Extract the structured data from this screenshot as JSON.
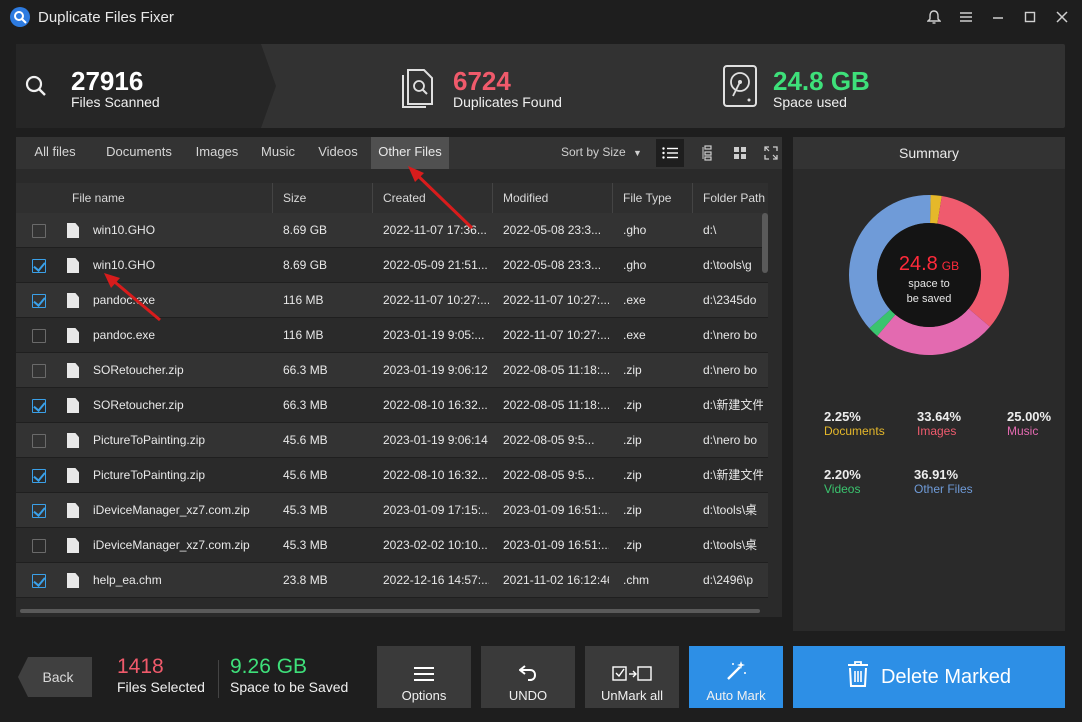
{
  "app": {
    "title": "Duplicate Files Fixer"
  },
  "stats": {
    "scanned": {
      "value": "27916",
      "label": "Files Scanned"
    },
    "duplicates": {
      "value": "6724",
      "label": "Duplicates Found"
    },
    "space": {
      "value": "24.8 GB",
      "label": "Space used"
    }
  },
  "tabs": [
    "All files",
    "Documents",
    "Images",
    "Music",
    "Videos",
    "Other Files"
  ],
  "sort_label": "Sort by Size",
  "columns": [
    "File name",
    "Size",
    "Created",
    "Modified",
    "File Type",
    "Folder Path"
  ],
  "rows": [
    {
      "checked": false,
      "name": "win10.GHO",
      "size": "8.69 GB",
      "created": "2022-11-07 17:36...",
      "modified": "2022-05-08 23:3...",
      "type": ".gho",
      "path": "d:\\"
    },
    {
      "checked": true,
      "name": "win10.GHO",
      "size": "8.69 GB",
      "created": "2022-05-09 21:51...",
      "modified": "2022-05-08 23:3...",
      "type": ".gho",
      "path": "d:\\tools\\g"
    },
    {
      "checked": true,
      "name": "pandoc.exe",
      "size": "116 MB",
      "created": "2022-11-07 10:27:...",
      "modified": "2022-11-07 10:27:...",
      "type": ".exe",
      "path": "d:\\2345do"
    },
    {
      "checked": false,
      "name": "pandoc.exe",
      "size": "116 MB",
      "created": "2023-01-19 9:05:...",
      "modified": "2022-11-07 10:27:...",
      "type": ".exe",
      "path": "d:\\nero bo"
    },
    {
      "checked": false,
      "name": "SORetoucher.zip",
      "size": "66.3 MB",
      "created": "2023-01-19 9:06:12",
      "modified": "2022-08-05 11:18:...",
      "type": ".zip",
      "path": "d:\\nero bo"
    },
    {
      "checked": true,
      "name": "SORetoucher.zip",
      "size": "66.3 MB",
      "created": "2022-08-10 16:32...",
      "modified": "2022-08-05 11:18:...",
      "type": ".zip",
      "path": "d:\\新建文件"
    },
    {
      "checked": false,
      "name": "PictureToPainting.zip",
      "size": "45.6 MB",
      "created": "2023-01-19 9:06:14",
      "modified": "2022-08-05 9:5...",
      "type": ".zip",
      "path": "d:\\nero bo"
    },
    {
      "checked": true,
      "name": "PictureToPainting.zip",
      "size": "45.6 MB",
      "created": "2022-08-10 16:32...",
      "modified": "2022-08-05 9:5...",
      "type": ".zip",
      "path": "d:\\新建文件"
    },
    {
      "checked": true,
      "name": "iDeviceManager_xz7.com.zip",
      "size": "45.3 MB",
      "created": "2023-01-09 17:15:...",
      "modified": "2023-01-09 16:51:...",
      "type": ".zip",
      "path": "d:\\tools\\桌"
    },
    {
      "checked": false,
      "name": "iDeviceManager_xz7.com.zip",
      "size": "45.3 MB",
      "created": "2023-02-02 10:10...",
      "modified": "2023-01-09 16:51:...",
      "type": ".zip",
      "path": "d:\\tools\\桌"
    },
    {
      "checked": true,
      "name": "help_ea.chm",
      "size": "23.8 MB",
      "created": "2022-12-16 14:57:...",
      "modified": "2021-11-02 16:12:46",
      "type": ".chm",
      "path": "d:\\2496\\p"
    }
  ],
  "summary": {
    "title": "Summary",
    "center_value": "24.8",
    "center_unit": "GB",
    "center_text_1": "space to",
    "center_text_2": "be saved",
    "legend": [
      {
        "pct": "2.25%",
        "label": "Documents",
        "color": "#e5b82a",
        "share": 2.25
      },
      {
        "pct": "33.64%",
        "label": "Images",
        "color": "#ef5b6e",
        "share": 33.64
      },
      {
        "pct": "25.00%",
        "label": "Music",
        "color": "#e36ab0",
        "share": 25.0
      },
      {
        "pct": "2.20%",
        "label": "Videos",
        "color": "#3ac46e",
        "share": 2.2
      },
      {
        "pct": "36.91%",
        "label": "Other Files",
        "color": "#6f9bd8",
        "share": 36.91
      }
    ]
  },
  "bottom": {
    "back": "Back",
    "selected": {
      "value": "1418",
      "label": "Files Selected"
    },
    "saved": {
      "value": "9.26 GB",
      "label": "Space to be Saved"
    },
    "options": "Options",
    "undo": "UNDO",
    "unmark": "UnMark all",
    "automark": "Auto Mark",
    "delete": "Delete Marked"
  },
  "colors": {
    "accent_blue": "#2d8fe6",
    "dup_red": "#f05a6b",
    "space_green": "#3ee07a"
  }
}
